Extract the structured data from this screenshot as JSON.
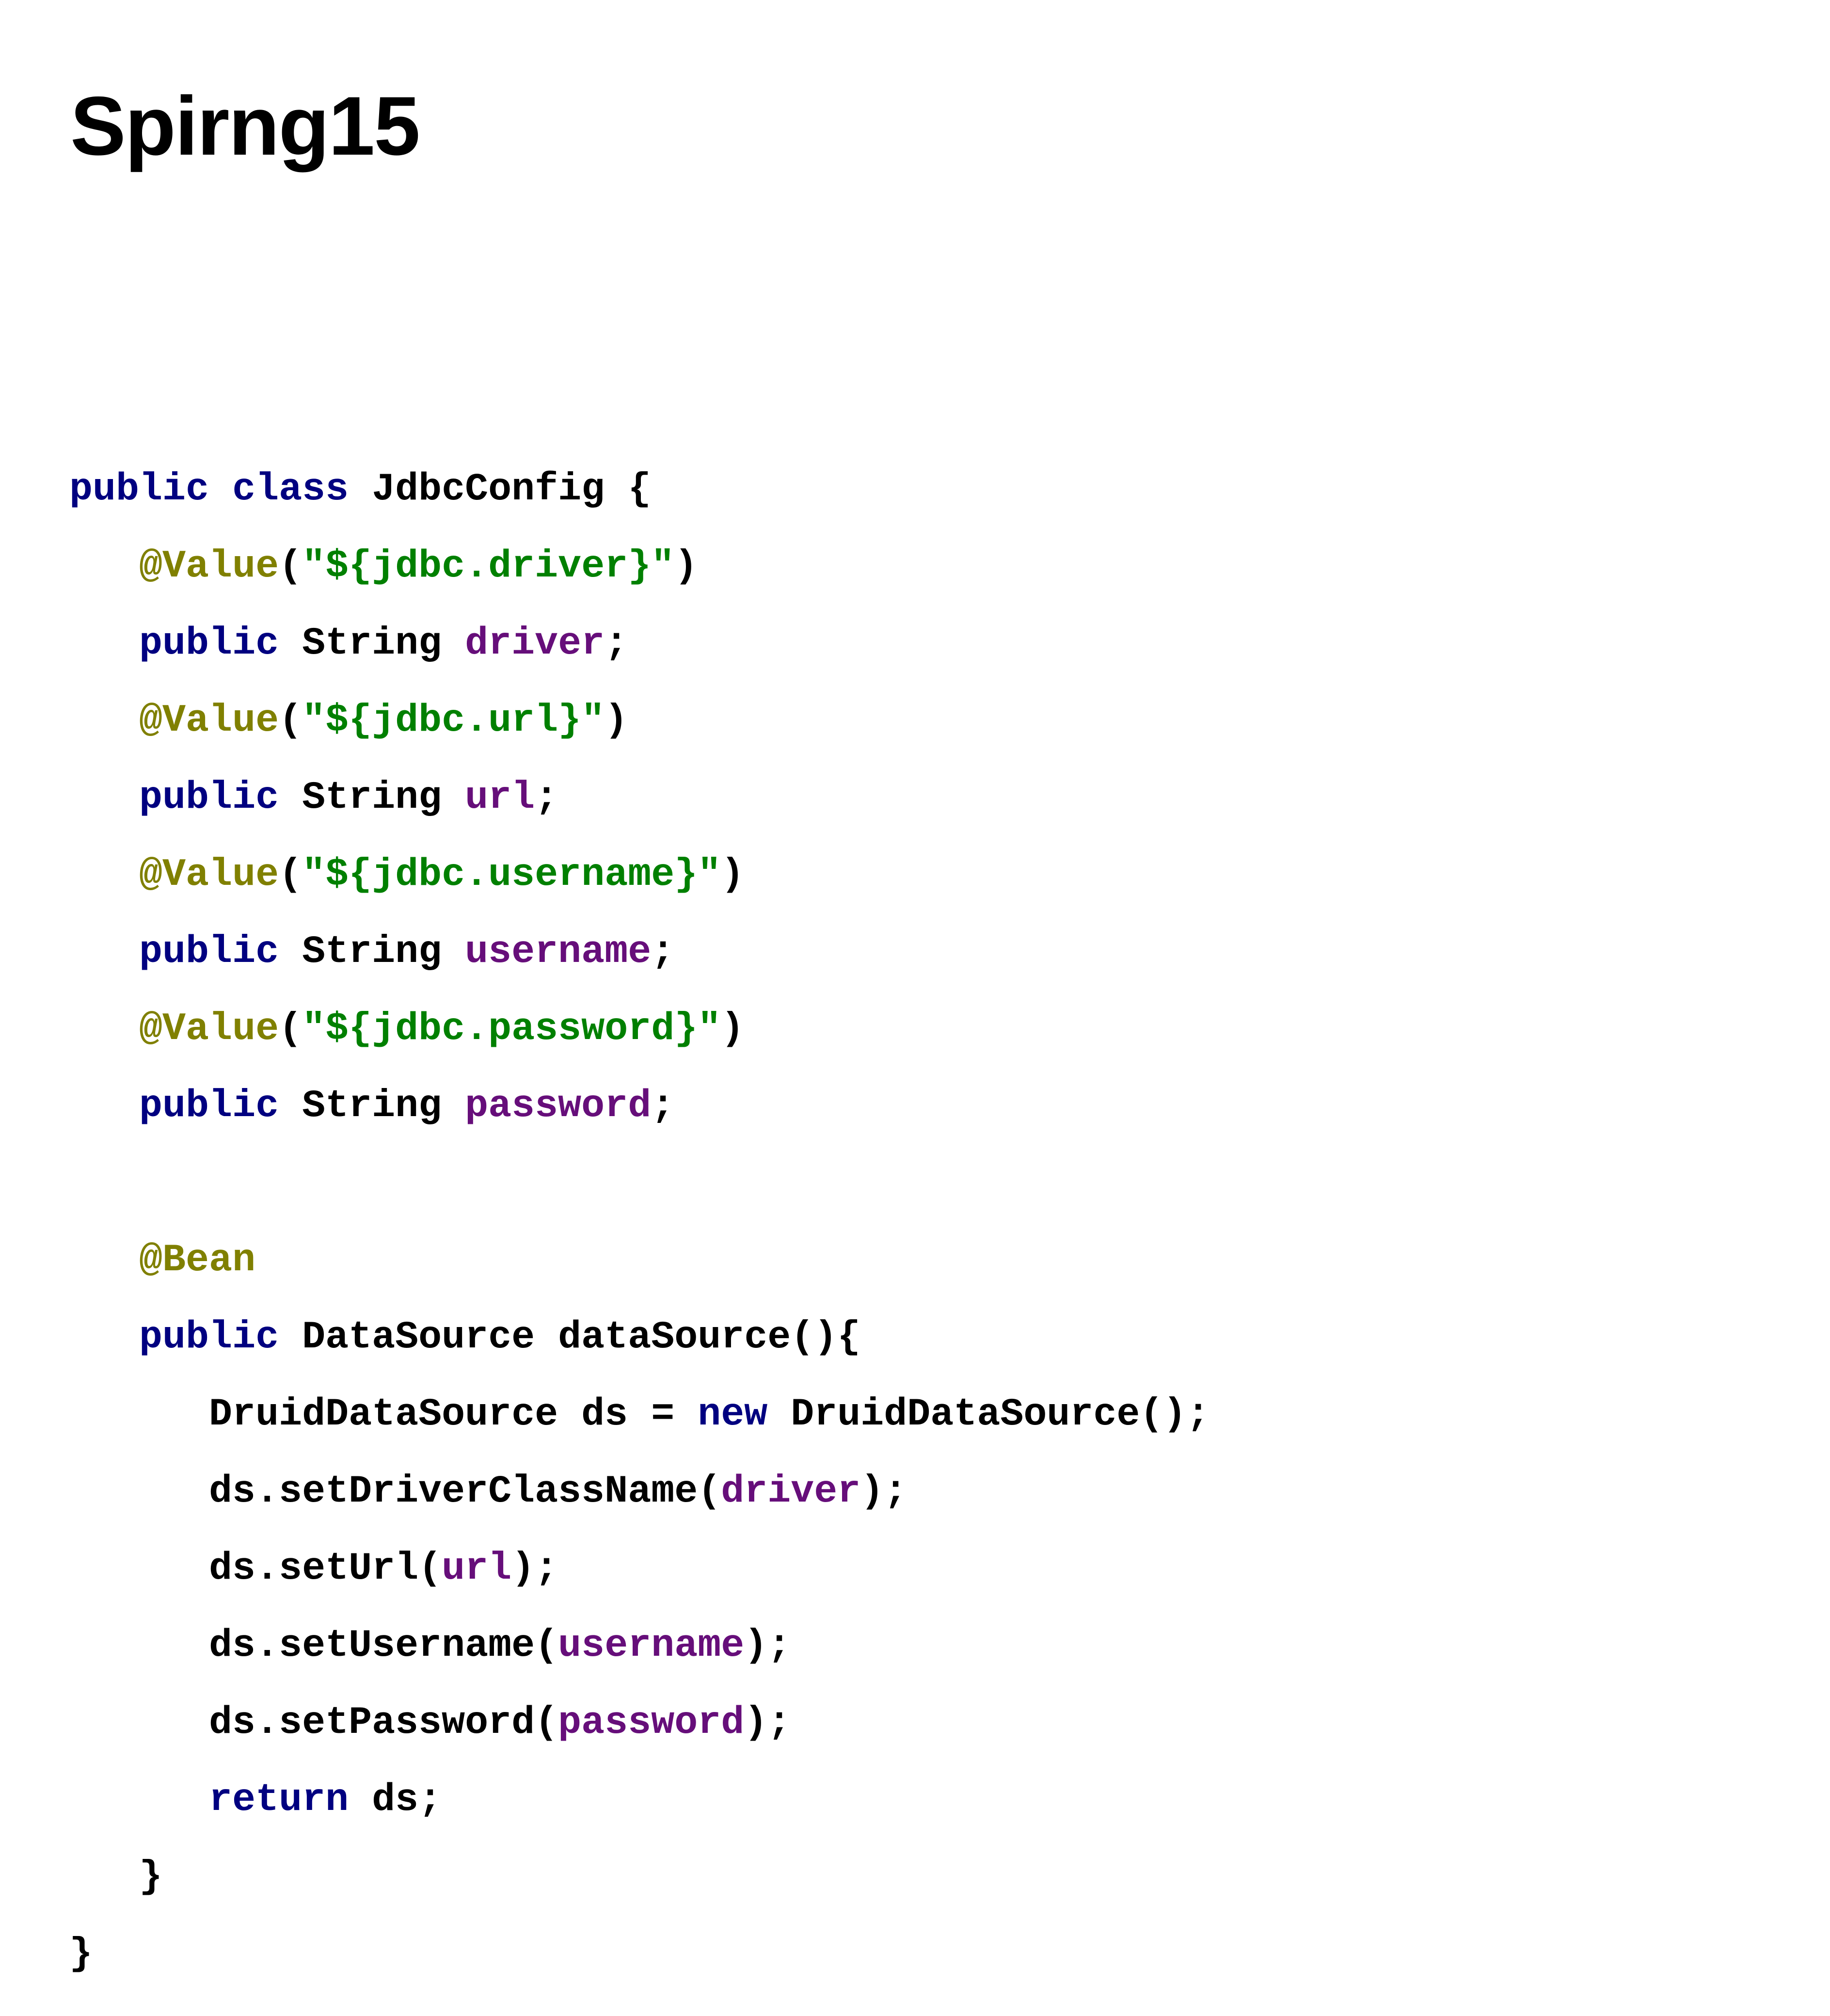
{
  "document": {
    "title": "Spirng15"
  },
  "colors": {
    "keyword": "#000080",
    "annotation": "#808000",
    "string": "#008000",
    "field": "#660e7a",
    "plain": "#000000"
  },
  "code": {
    "lines": [
      [
        [
          "kw",
          "public"
        ],
        [
          "pln",
          " "
        ],
        [
          "kw",
          "class"
        ],
        [
          "pln",
          " JdbcConfig {"
        ]
      ],
      [
        [
          "pln",
          "   "
        ],
        [
          "ann",
          "@Value"
        ],
        [
          "pln",
          "("
        ],
        [
          "str",
          "\"${jdbc.driver}\""
        ],
        [
          "pln",
          ")"
        ]
      ],
      [
        [
          "pln",
          "   "
        ],
        [
          "kw",
          "public"
        ],
        [
          "pln",
          " String "
        ],
        [
          "fld",
          "driver"
        ],
        [
          "pln",
          ";"
        ]
      ],
      [
        [
          "pln",
          "   "
        ],
        [
          "ann",
          "@Value"
        ],
        [
          "pln",
          "("
        ],
        [
          "str",
          "\"${jdbc.url}\""
        ],
        [
          "pln",
          ")"
        ]
      ],
      [
        [
          "pln",
          "   "
        ],
        [
          "kw",
          "public"
        ],
        [
          "pln",
          " String "
        ],
        [
          "fld",
          "url"
        ],
        [
          "pln",
          ";"
        ]
      ],
      [
        [
          "pln",
          "   "
        ],
        [
          "ann",
          "@Value"
        ],
        [
          "pln",
          "("
        ],
        [
          "str",
          "\"${jdbc.username}\""
        ],
        [
          "pln",
          ")"
        ]
      ],
      [
        [
          "pln",
          "   "
        ],
        [
          "kw",
          "public"
        ],
        [
          "pln",
          " String "
        ],
        [
          "fld",
          "username"
        ],
        [
          "pln",
          ";"
        ]
      ],
      [
        [
          "pln",
          "   "
        ],
        [
          "ann",
          "@Value"
        ],
        [
          "pln",
          "("
        ],
        [
          "str",
          "\"${jdbc.password}\""
        ],
        [
          "pln",
          ")"
        ]
      ],
      [
        [
          "pln",
          "   "
        ],
        [
          "kw",
          "public"
        ],
        [
          "pln",
          " String "
        ],
        [
          "fld",
          "password"
        ],
        [
          "pln",
          ";"
        ]
      ],
      [],
      [
        [
          "pln",
          "   "
        ],
        [
          "ann",
          "@Bean"
        ]
      ],
      [
        [
          "pln",
          "   "
        ],
        [
          "kw",
          "public"
        ],
        [
          "pln",
          " DataSource dataSource(){"
        ]
      ],
      [
        [
          "pln",
          "      DruidDataSource ds = "
        ],
        [
          "kw",
          "new"
        ],
        [
          "pln",
          " DruidDataSource();"
        ]
      ],
      [
        [
          "pln",
          "      ds.setDriverClassName("
        ],
        [
          "fld",
          "driver"
        ],
        [
          "pln",
          ");"
        ]
      ],
      [
        [
          "pln",
          "      ds.setUrl("
        ],
        [
          "fld",
          "url"
        ],
        [
          "pln",
          ");"
        ]
      ],
      [
        [
          "pln",
          "      ds.setUsername("
        ],
        [
          "fld",
          "username"
        ],
        [
          "pln",
          ");"
        ]
      ],
      [
        [
          "pln",
          "      ds.setPassword("
        ],
        [
          "fld",
          "password"
        ],
        [
          "pln",
          ");"
        ]
      ],
      [
        [
          "pln",
          "      "
        ],
        [
          "kw",
          "return"
        ],
        [
          "pln",
          " ds;"
        ]
      ],
      [
        [
          "pln",
          "   }"
        ]
      ],
      [
        [
          "pln",
          "}"
        ]
      ]
    ]
  }
}
